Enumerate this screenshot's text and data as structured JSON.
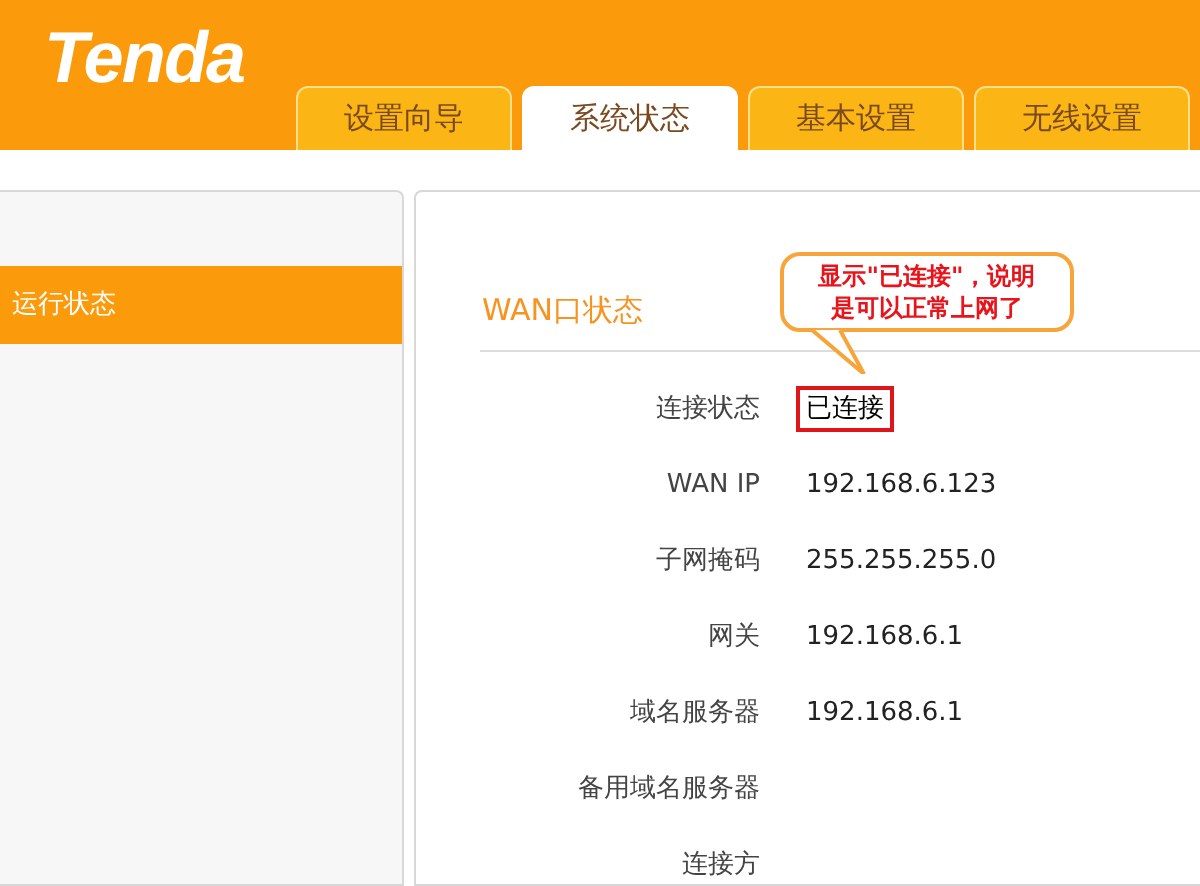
{
  "logo": "Tenda",
  "tabs": [
    {
      "label": "设置向导",
      "selected": false
    },
    {
      "label": "系统状态",
      "selected": true
    },
    {
      "label": "基本设置",
      "selected": false
    },
    {
      "label": "无线设置",
      "selected": false
    }
  ],
  "sidebar": {
    "items": [
      {
        "label": "运行状态",
        "selected": true
      }
    ]
  },
  "section_title": "WAN口状态",
  "rows": [
    {
      "label": "连接状态",
      "value": "已连接"
    },
    {
      "label": "WAN IP",
      "value": "192.168.6.123"
    },
    {
      "label": "子网掩码",
      "value": "255.255.255.0"
    },
    {
      "label": "网关",
      "value": "192.168.6.1"
    },
    {
      "label": "域名服务器",
      "value": "192.168.6.1"
    },
    {
      "label": "备用域名服务器"
    },
    {
      "label": "连接方"
    }
  ],
  "callout": {
    "lines": [
      "显示\"已连接\"，说明",
      "是可以正常上网了"
    ],
    "target_boxed": true
  }
}
